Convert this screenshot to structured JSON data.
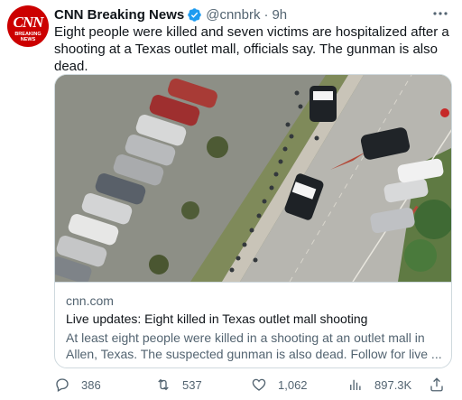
{
  "account": {
    "display_name": "CNN Breaking News",
    "handle": "@cnnbrk",
    "separator": "·",
    "time": "9h",
    "avatar": {
      "logo_text": "CNN",
      "sub_text": "BREAKING NEWS"
    }
  },
  "tweet": {
    "text": "Eight people were killed and seven victims are hospitalized after a shooting at a Texas outlet mall, officials say. The gunman is also dead."
  },
  "card": {
    "image_icon": "aerial-photo-police-parking-lot",
    "domain": "cnn.com",
    "title": "Live updates: Eight killed in Texas outlet mall shooting",
    "description": "At least eight people were killed in a shooting at an outlet mall in Allen, Texas. The suspected gunman is also dead. Follow for live ..."
  },
  "actions": {
    "reply_count": "386",
    "retweet_count": "537",
    "like_count": "1,062",
    "view_count": "897.3K"
  },
  "colors": {
    "verified": "#1d9bf0",
    "muted": "#536471",
    "brand": "#cc0000"
  }
}
